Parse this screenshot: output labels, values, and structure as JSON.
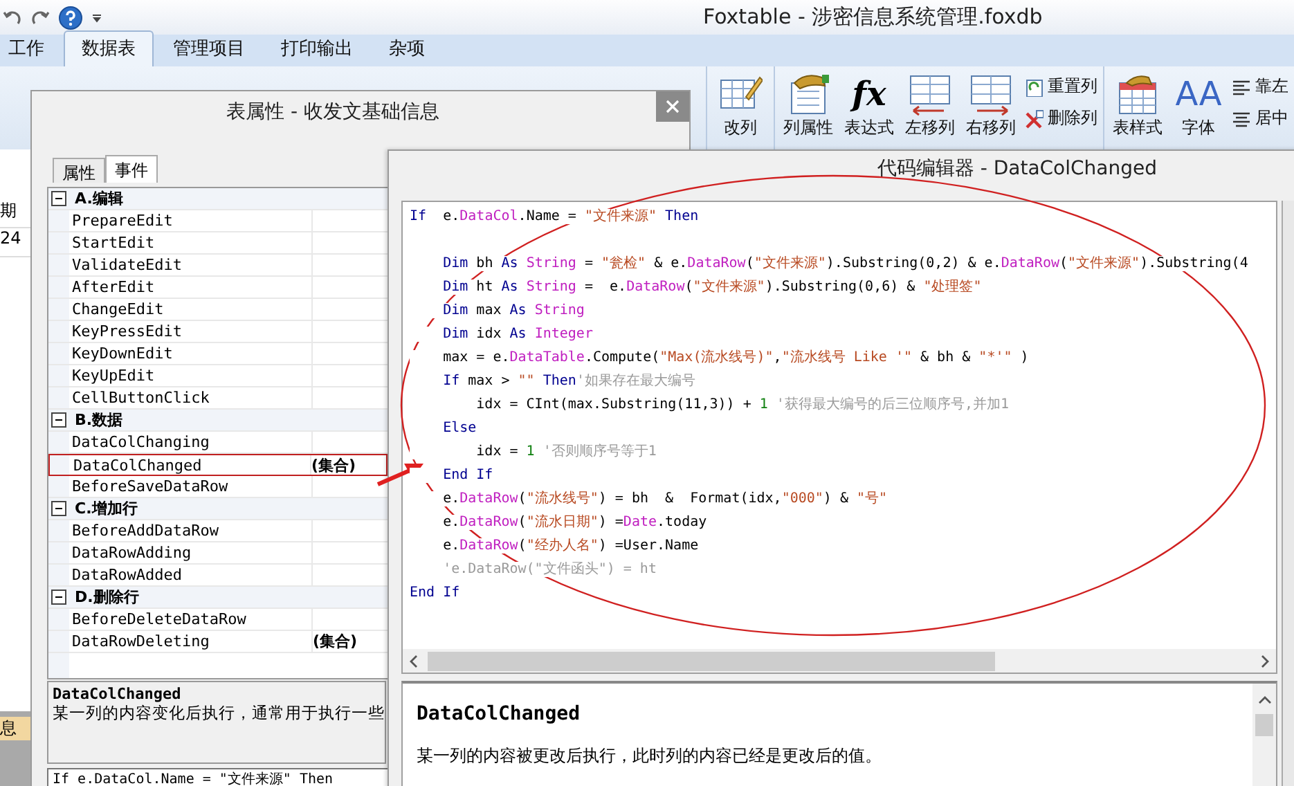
{
  "window": {
    "title": "Foxtable - 涉密信息系统管理.foxdb"
  },
  "ribbon_tabs": [
    {
      "label": "工作",
      "selected": false
    },
    {
      "label": "数据表",
      "selected": true
    },
    {
      "label": "管理项目",
      "selected": false
    },
    {
      "label": "打印输出",
      "selected": false
    },
    {
      "label": "杂项",
      "selected": false
    }
  ],
  "left_strip": {
    "cells": [
      "期",
      "24"
    ],
    "notes": [
      "息"
    ]
  },
  "ribbon": {
    "groups": [
      {
        "items": [
          {
            "kind": "large",
            "label": "改列"
          }
        ]
      },
      {
        "items": [
          {
            "kind": "large",
            "label": "列属性"
          },
          {
            "kind": "large",
            "label": "表达式",
            "icon_text": "fx"
          },
          {
            "kind": "large",
            "label": "左移列"
          },
          {
            "kind": "large",
            "label": "右移列"
          },
          {
            "kind": "small",
            "label": "重置列"
          },
          {
            "kind": "small",
            "label": "删除列"
          }
        ]
      },
      {
        "items": [
          {
            "kind": "large",
            "label": "表样式"
          },
          {
            "kind": "large",
            "label": "字体",
            "icon_text": "AA"
          },
          {
            "kind": "small",
            "label": "靠左"
          },
          {
            "kind": "small",
            "label": "居中"
          }
        ]
      }
    ]
  },
  "table_dialog": {
    "title": "表属性 - 收发文基础信息",
    "tabs": [
      {
        "label": "属性",
        "selected": false
      },
      {
        "label": "事件",
        "selected": true
      }
    ],
    "property_grid": {
      "groups": [
        {
          "label": "A.编辑",
          "expanded": true,
          "items": [
            {
              "name": "PrepareEdit"
            },
            {
              "name": "StartEdit"
            },
            {
              "name": "ValidateEdit"
            },
            {
              "name": "AfterEdit"
            },
            {
              "name": "ChangeEdit"
            },
            {
              "name": "KeyPressEdit"
            },
            {
              "name": "KeyDownEdit"
            },
            {
              "name": "KeyUpEdit"
            },
            {
              "name": "CellButtonClick"
            }
          ]
        },
        {
          "label": "B.数据",
          "expanded": true,
          "items": [
            {
              "name": "DataColChanging"
            },
            {
              "name": "DataColChanged",
              "value": "(集合)",
              "marked": true
            },
            {
              "name": "BeforeSaveDataRow"
            }
          ]
        },
        {
          "label": "C.增加行",
          "expanded": true,
          "items": [
            {
              "name": "BeforeAddDataRow"
            },
            {
              "name": "DataRowAdding"
            },
            {
              "name": "DataRowAdded"
            }
          ]
        },
        {
          "label": "D.删除行",
          "expanded": true,
          "items": [
            {
              "name": "BeforeDeleteDataRow"
            },
            {
              "name": "DataRowDeleting",
              "value": "(集合)"
            }
          ]
        }
      ]
    },
    "description": {
      "title": "DataColChanged",
      "text": "某一列的内容变化后执行，通常用于执行一些"
    },
    "code_preview": "If  e.DataCol.Name = \"文件来源\" Then"
  },
  "code_editor": {
    "title": "代码编辑器 - DataColChanged",
    "lines": [
      {
        "kind": "code",
        "tokens": [
          {
            "kind": "keyword",
            "text": "If"
          },
          {
            "kind": "plain",
            "text": "  e."
          },
          {
            "kind": "member",
            "text": "DataCol"
          },
          {
            "kind": "plain",
            "text": ".Name = "
          },
          {
            "kind": "string",
            "text": "\"文件来源\""
          },
          {
            "kind": "keyword",
            "text": " Then"
          }
        ]
      },
      {
        "kind": "blank"
      },
      {
        "kind": "code",
        "tokens": [
          {
            "kind": "keyword",
            "text": "    Dim"
          },
          {
            "kind": "plain",
            "text": " bh "
          },
          {
            "kind": "keyword",
            "text": "As"
          },
          {
            "kind": "member",
            "text": " String"
          },
          {
            "kind": "plain",
            "text": " = "
          },
          {
            "kind": "string",
            "text": "\"瓮检\""
          },
          {
            "kind": "plain",
            "text": " & e."
          },
          {
            "kind": "member",
            "text": "DataRow"
          },
          {
            "kind": "plain",
            "text": "("
          },
          {
            "kind": "string",
            "text": "\"文件来源\""
          },
          {
            "kind": "plain",
            "text": ").Substring(0,2) & e."
          },
          {
            "kind": "member",
            "text": "DataRow"
          },
          {
            "kind": "plain",
            "text": "("
          },
          {
            "kind": "string",
            "text": "\"文件来源\""
          },
          {
            "kind": "plain",
            "text": ").Substring(4"
          }
        ]
      },
      {
        "kind": "code",
        "tokens": [
          {
            "kind": "keyword",
            "text": "    Dim"
          },
          {
            "kind": "plain",
            "text": " ht "
          },
          {
            "kind": "keyword",
            "text": "As"
          },
          {
            "kind": "member",
            "text": " String"
          },
          {
            "kind": "plain",
            "text": " =  e."
          },
          {
            "kind": "member",
            "text": "DataRow"
          },
          {
            "kind": "plain",
            "text": "("
          },
          {
            "kind": "string",
            "text": "\"文件来源\""
          },
          {
            "kind": "plain",
            "text": ").Substring(0,6) & "
          },
          {
            "kind": "string",
            "text": "\"处理签\""
          }
        ]
      },
      {
        "kind": "code",
        "tokens": [
          {
            "kind": "keyword",
            "text": "    Dim"
          },
          {
            "kind": "plain",
            "text": " max "
          },
          {
            "kind": "keyword",
            "text": "As"
          },
          {
            "kind": "member",
            "text": " String"
          }
        ]
      },
      {
        "kind": "code",
        "tokens": [
          {
            "kind": "keyword",
            "text": "    Dim"
          },
          {
            "kind": "plain",
            "text": " idx "
          },
          {
            "kind": "keyword",
            "text": "As"
          },
          {
            "kind": "member",
            "text": " Integer"
          }
        ]
      },
      {
        "kind": "code",
        "tokens": [
          {
            "kind": "plain",
            "text": "    max = e."
          },
          {
            "kind": "member",
            "text": "DataTable"
          },
          {
            "kind": "plain",
            "text": ".Compute("
          },
          {
            "kind": "string",
            "text": "\"Max(流水线号)\""
          },
          {
            "kind": "plain",
            "text": ","
          },
          {
            "kind": "string",
            "text": "\"流水线号 Like '\""
          },
          {
            "kind": "plain",
            "text": " & bh & "
          },
          {
            "kind": "string",
            "text": "\"*'\""
          },
          {
            "kind": "plain",
            "text": " )"
          }
        ]
      },
      {
        "kind": "code",
        "tokens": [
          {
            "kind": "keyword",
            "text": "    If"
          },
          {
            "kind": "plain",
            "text": " max > "
          },
          {
            "kind": "string",
            "text": "\"\""
          },
          {
            "kind": "keyword",
            "text": " Then"
          },
          {
            "kind": "comment",
            "text": "'如果存在最大编号"
          }
        ]
      },
      {
        "kind": "code",
        "tokens": [
          {
            "kind": "plain",
            "text": "        idx = CInt(max.Substring(11,3)) + "
          },
          {
            "kind": "number",
            "text": "1"
          },
          {
            "kind": "comment",
            "text": " '获得最大编号的后三位顺序号,并加1"
          }
        ]
      },
      {
        "kind": "code",
        "tokens": [
          {
            "kind": "keyword",
            "text": "    Else"
          }
        ]
      },
      {
        "kind": "code",
        "tokens": [
          {
            "kind": "plain",
            "text": "        idx = "
          },
          {
            "kind": "number",
            "text": "1"
          },
          {
            "kind": "comment",
            "text": " '否则顺序号等于1"
          }
        ]
      },
      {
        "kind": "code",
        "tokens": [
          {
            "kind": "keyword",
            "text": "    End If"
          }
        ]
      },
      {
        "kind": "code",
        "tokens": [
          {
            "kind": "plain",
            "text": "    e."
          },
          {
            "kind": "member",
            "text": "DataRow"
          },
          {
            "kind": "plain",
            "text": "("
          },
          {
            "kind": "string",
            "text": "\"流水线号\""
          },
          {
            "kind": "plain",
            "text": ") = bh  &  Format(idx,"
          },
          {
            "kind": "string",
            "text": "\"000\""
          },
          {
            "kind": "plain",
            "text": ") & "
          },
          {
            "kind": "string",
            "text": "\"号\""
          }
        ]
      },
      {
        "kind": "code",
        "tokens": [
          {
            "kind": "plain",
            "text": "    e."
          },
          {
            "kind": "member",
            "text": "DataRow"
          },
          {
            "kind": "plain",
            "text": "("
          },
          {
            "kind": "string",
            "text": "\"流水日期\""
          },
          {
            "kind": "plain",
            "text": ") ="
          },
          {
            "kind": "member",
            "text": "Date"
          },
          {
            "kind": "plain",
            "text": ".today"
          }
        ]
      },
      {
        "kind": "code",
        "tokens": [
          {
            "kind": "plain",
            "text": "    e."
          },
          {
            "kind": "member",
            "text": "DataRow"
          },
          {
            "kind": "plain",
            "text": "("
          },
          {
            "kind": "string",
            "text": "\"经办人名\""
          },
          {
            "kind": "plain",
            "text": ") =User.Name"
          }
        ]
      },
      {
        "kind": "code",
        "tokens": [
          {
            "kind": "comment",
            "text": "    'e.DataRow(\"文件函头\") = ht"
          }
        ]
      },
      {
        "kind": "code",
        "tokens": [
          {
            "kind": "keyword",
            "text": "End If"
          }
        ]
      }
    ],
    "help": {
      "title": "DataColChanged",
      "text": "某一列的内容被更改后执行，此时列的内容已经是更改后的值。"
    }
  }
}
